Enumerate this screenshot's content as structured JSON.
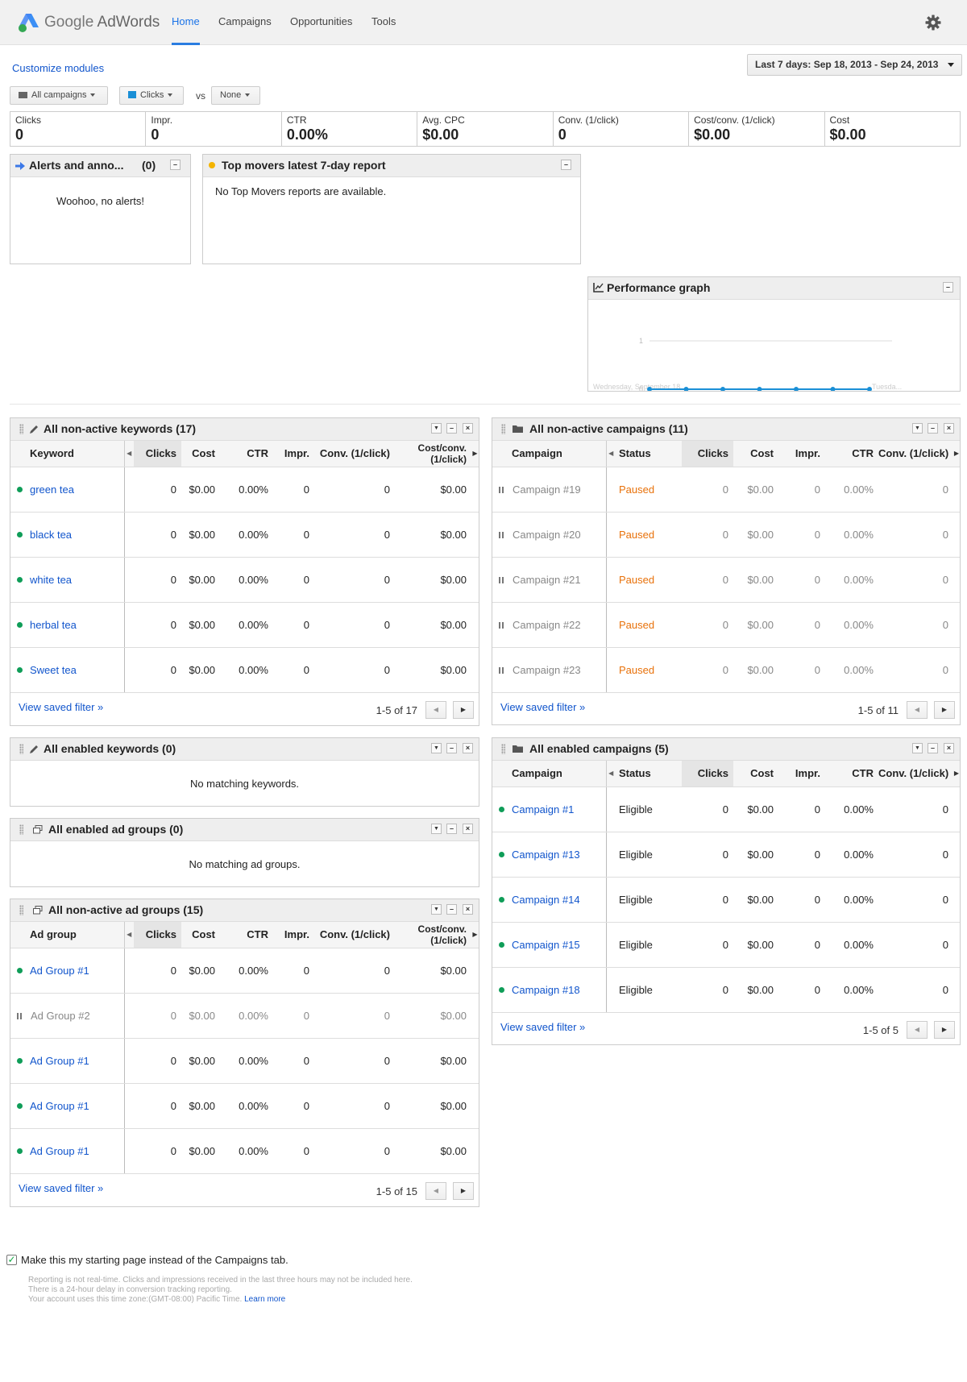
{
  "header": {
    "logo_brand": "Google",
    "logo_product": "AdWords",
    "nav": [
      "Home",
      "Campaigns",
      "Opportunities",
      "Tools"
    ],
    "active_nav": "Home"
  },
  "toolbar": {
    "customize": "Customize modules",
    "date_range": "Last 7 days: Sep 18, 2013 - Sep 24, 2013",
    "campaign_filter": "All campaigns",
    "metric1": "Clicks",
    "vs": "vs",
    "metric2": "None"
  },
  "stats": [
    {
      "label": "Clicks",
      "value": "0"
    },
    {
      "label": "Impr.",
      "value": "0"
    },
    {
      "label": "CTR",
      "value": "0.00%"
    },
    {
      "label": "Avg. CPC",
      "value": "$0.00"
    },
    {
      "label": "Conv. (1/click)",
      "value": "0"
    },
    {
      "label": "Cost/conv. (1/click)",
      "value": "$0.00"
    },
    {
      "label": "Cost",
      "value": "$0.00"
    }
  ],
  "alerts": {
    "title": "Alerts and anno...",
    "count": "(0)",
    "message": "Woohoo, no alerts!"
  },
  "top_movers": {
    "title": "Top movers latest 7-day report",
    "message": "No Top Movers reports are available."
  },
  "performance": {
    "title": "Performance graph"
  },
  "chart_data": {
    "type": "line",
    "title": "Performance graph",
    "series": [
      {
        "name": "Clicks",
        "values": [
          0,
          0,
          0,
          0,
          0,
          0,
          0
        ]
      }
    ],
    "x_labels": [
      "Wednesday, September 18...",
      "Tuesda..."
    ],
    "y_ticks": [
      "0",
      "1"
    ],
    "ylim": [
      0,
      1
    ],
    "grid": true
  },
  "kw_nonactive": {
    "title": "All non-active keywords (17)",
    "headers": [
      "Keyword",
      "Clicks",
      "Cost",
      "CTR",
      "Impr.",
      "Conv. (1/click)",
      "Cost/conv. (1/click)"
    ],
    "rows": [
      {
        "name": "green tea",
        "clicks": "0",
        "cost": "$0.00",
        "ctr": "0.00%",
        "impr": "0",
        "conv": "0",
        "costconv": "$0.00"
      },
      {
        "name": "black tea",
        "clicks": "0",
        "cost": "$0.00",
        "ctr": "0.00%",
        "impr": "0",
        "conv": "0",
        "costconv": "$0.00"
      },
      {
        "name": "white tea",
        "clicks": "0",
        "cost": "$0.00",
        "ctr": "0.00%",
        "impr": "0",
        "conv": "0",
        "costconv": "$0.00"
      },
      {
        "name": "herbal tea",
        "clicks": "0",
        "cost": "$0.00",
        "ctr": "0.00%",
        "impr": "0",
        "conv": "0",
        "costconv": "$0.00"
      },
      {
        "name": "Sweet tea",
        "clicks": "0",
        "cost": "$0.00",
        "ctr": "0.00%",
        "impr": "0",
        "conv": "0",
        "costconv": "$0.00"
      }
    ],
    "filter": "View saved filter »",
    "pagination": "1-5 of 17"
  },
  "kw_enabled": {
    "title": "All enabled keywords (0)",
    "message": "No matching keywords."
  },
  "ag_enabled": {
    "title": "All enabled ad groups (0)",
    "message": "No matching ad groups."
  },
  "ag_nonactive": {
    "title": "All non-active ad groups (15)",
    "headers": [
      "Ad group",
      "Clicks",
      "Cost",
      "CTR",
      "Impr.",
      "Conv. (1/click)",
      "Cost/conv. (1/click)"
    ],
    "rows": [
      {
        "name": "Ad Group #1",
        "status": "enabled",
        "clicks": "0",
        "cost": "$0.00",
        "ctr": "0.00%",
        "impr": "0",
        "conv": "0",
        "costconv": "$0.00"
      },
      {
        "name": "Ad Group #2",
        "status": "paused",
        "clicks": "0",
        "cost": "$0.00",
        "ctr": "0.00%",
        "impr": "0",
        "conv": "0",
        "costconv": "$0.00"
      },
      {
        "name": "Ad Group #1",
        "status": "enabled",
        "clicks": "0",
        "cost": "$0.00",
        "ctr": "0.00%",
        "impr": "0",
        "conv": "0",
        "costconv": "$0.00"
      },
      {
        "name": "Ad Group #1",
        "status": "enabled",
        "clicks": "0",
        "cost": "$0.00",
        "ctr": "0.00%",
        "impr": "0",
        "conv": "0",
        "costconv": "$0.00"
      },
      {
        "name": "Ad Group #1",
        "status": "enabled",
        "clicks": "0",
        "cost": "$0.00",
        "ctr": "0.00%",
        "impr": "0",
        "conv": "0",
        "costconv": "$0.00"
      }
    ],
    "filter": "View saved filter »",
    "pagination": "1-5 of 15"
  },
  "camp_nonactive": {
    "title": "All non-active campaigns (11)",
    "headers": [
      "Campaign",
      "Status",
      "Clicks",
      "Cost",
      "Impr.",
      "CTR",
      "Conv. (1/click)"
    ],
    "rows": [
      {
        "name": "Campaign #19",
        "status": "Paused",
        "clicks": "0",
        "cost": "$0.00",
        "impr": "0",
        "ctr": "0.00%",
        "conv": "0"
      },
      {
        "name": "Campaign #20",
        "status": "Paused",
        "clicks": "0",
        "cost": "$0.00",
        "impr": "0",
        "ctr": "0.00%",
        "conv": "0"
      },
      {
        "name": "Campaign #21",
        "status": "Paused",
        "clicks": "0",
        "cost": "$0.00",
        "impr": "0",
        "ctr": "0.00%",
        "conv": "0"
      },
      {
        "name": "Campaign #22",
        "status": "Paused",
        "clicks": "0",
        "cost": "$0.00",
        "impr": "0",
        "ctr": "0.00%",
        "conv": "0"
      },
      {
        "name": "Campaign #23",
        "status": "Paused",
        "clicks": "0",
        "cost": "$0.00",
        "impr": "0",
        "ctr": "0.00%",
        "conv": "0"
      }
    ],
    "filter": "View saved filter »",
    "pagination": "1-5 of 11"
  },
  "camp_enabled": {
    "title": "All enabled campaigns (5)",
    "headers": [
      "Campaign",
      "Status",
      "Clicks",
      "Cost",
      "Impr.",
      "CTR",
      "Conv. (1/click)"
    ],
    "rows": [
      {
        "name": "Campaign #1",
        "status": "Eligible",
        "clicks": "0",
        "cost": "$0.00",
        "impr": "0",
        "ctr": "0.00%",
        "conv": "0"
      },
      {
        "name": "Campaign #13",
        "status": "Eligible",
        "clicks": "0",
        "cost": "$0.00",
        "impr": "0",
        "ctr": "0.00%",
        "conv": "0"
      },
      {
        "name": "Campaign #14",
        "status": "Eligible",
        "clicks": "0",
        "cost": "$0.00",
        "impr": "0",
        "ctr": "0.00%",
        "conv": "0"
      },
      {
        "name": "Campaign #15",
        "status": "Eligible",
        "clicks": "0",
        "cost": "$0.00",
        "impr": "0",
        "ctr": "0.00%",
        "conv": "0"
      },
      {
        "name": "Campaign #18",
        "status": "Eligible",
        "clicks": "0",
        "cost": "$0.00",
        "impr": "0",
        "ctr": "0.00%",
        "conv": "0"
      }
    ],
    "filter": "View saved filter »",
    "pagination": "1-5 of 5"
  },
  "footer": {
    "checkbox_label": "Make this my starting page instead of the Campaigns tab.",
    "note1": "Reporting is not real-time. Clicks and impressions received in the last three hours may not be included here.",
    "note2": "There is a 24-hour delay in conversion tracking reporting.",
    "note3": "Your account uses this time zone:(GMT-08:00) Pacific Time.",
    "learn_more": "Learn more"
  },
  "colors": {
    "accent": "#1a73e8",
    "link": "#1155cc",
    "enabled": "#0f9d58",
    "paused": "#e8710a",
    "series": "#1a8fd6"
  }
}
